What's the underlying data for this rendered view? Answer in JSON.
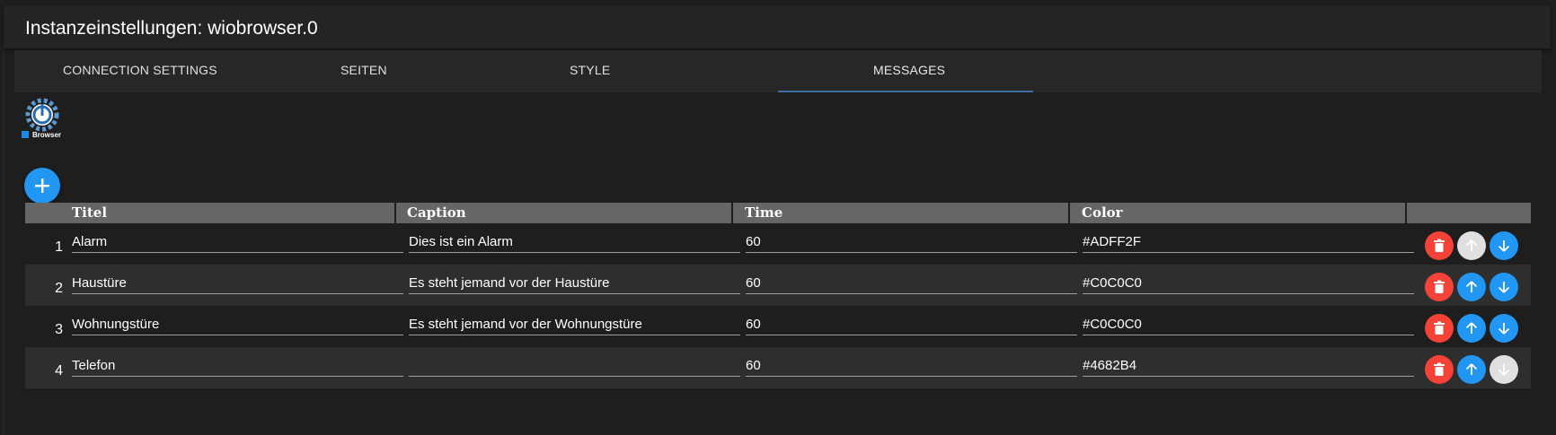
{
  "window": {
    "title": "Instanzeinstellungen: wiobrowser.0"
  },
  "tabs": [
    {
      "label": "CONNECTION SETTINGS",
      "active": false
    },
    {
      "label": "SEITEN",
      "active": false
    },
    {
      "label": "STYLE",
      "active": false
    },
    {
      "label": "MESSAGES",
      "active": true
    }
  ],
  "logo": {
    "icon": "wiobrowser-logo-icon",
    "text": "Browser"
  },
  "add_button": {
    "icon": "plus-icon"
  },
  "table": {
    "columns": [
      "Titel",
      "Caption",
      "Time",
      "Color"
    ],
    "rows": [
      {
        "index": "1",
        "titel": "Alarm",
        "caption": "Dies ist ein Alarm",
        "time": "60",
        "color": "#ADFF2F",
        "up_enabled": false,
        "down_enabled": true
      },
      {
        "index": "2",
        "titel": "Haustüre",
        "caption": "Es steht jemand vor der Haustüre",
        "time": "60",
        "color": "#C0C0C0",
        "up_enabled": true,
        "down_enabled": true
      },
      {
        "index": "3",
        "titel": "Wohnungstüre",
        "caption": "Es steht jemand vor der Wohnungstüre",
        "time": "60",
        "color": "#C0C0C0",
        "up_enabled": true,
        "down_enabled": true
      },
      {
        "index": "4",
        "titel": "Telefon",
        "caption": "",
        "time": "60",
        "color": "#4682B4",
        "up_enabled": true,
        "down_enabled": false
      }
    ],
    "row_icons": {
      "delete": "trash-icon",
      "up": "arrow-up-icon",
      "down": "arrow-down-icon"
    }
  },
  "colors": {
    "accent": "#2196f3",
    "delete": "#f44336",
    "disabled": "#e0e0e0",
    "tab_indicator": "#3d6fa3",
    "header_bg": "#666666"
  }
}
